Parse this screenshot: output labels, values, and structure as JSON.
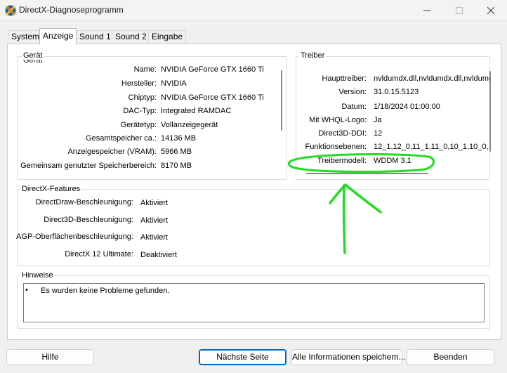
{
  "window": {
    "title": "DirectX-Diagnoseprogramm"
  },
  "tabs": [
    {
      "label": "System",
      "active": false
    },
    {
      "label": "Anzeige",
      "active": true
    },
    {
      "label": "Sound 1",
      "active": false
    },
    {
      "label": "Sound 2",
      "active": false
    },
    {
      "label": "Eingabe",
      "active": false
    }
  ],
  "device": {
    "title": "Gerät",
    "rows": [
      {
        "label": "Name:",
        "value": "NVIDIA GeForce GTX 1660 Ti"
      },
      {
        "label": "Hersteller:",
        "value": "NVIDIA"
      },
      {
        "label": "Chiptyp:",
        "value": "NVIDIA GeForce GTX 1660 Ti"
      },
      {
        "label": "DAC-Typ:",
        "value": "Integrated RAMDAC"
      },
      {
        "label": "Gerätetyp:",
        "value": "Vollanzeigegerät"
      },
      {
        "label": "Gesamtspeicher ca.:",
        "value": "14136 MB"
      },
      {
        "label": "Anzeigespeicher (VRAM):",
        "value": "5966 MB"
      },
      {
        "label": "Gemeinsam genutzter Speicherbereich:",
        "value": "8170 MB"
      }
    ]
  },
  "driver": {
    "title": "Treiber",
    "rows": [
      {
        "label": "Haupttreiber:",
        "value": "nvldumdx.dll,nvldumdx.dll,nvldumd"
      },
      {
        "label": "Version:",
        "value": "31.0.15.5123"
      },
      {
        "label": "Datum:",
        "value": "1/18/2024 01:00:00"
      },
      {
        "label": "Mit WHQL-Logo:",
        "value": "Ja"
      },
      {
        "label": "Direct3D-DDI:",
        "value": "12"
      },
      {
        "label": "Funktionsebenen:",
        "value": "12_1,12_0,11_1,11_0,10_1,10_0,"
      },
      {
        "label": "Treibermodell:",
        "value": "WDDM 3.1"
      }
    ]
  },
  "features": {
    "title": "DirectX-Features",
    "rows": [
      {
        "label": "DirectDraw-Beschleunigung:",
        "value": "Aktiviert"
      },
      {
        "label": "Direct3D-Beschleunigung:",
        "value": "Aktiviert"
      },
      {
        "label": "AGP-Oberflächenbeschleunigung:",
        "value": "Aktiviert"
      },
      {
        "label": "DirectX 12 Ultimate:",
        "value": "Deaktiviert"
      }
    ]
  },
  "notes": {
    "title": "Hinweise",
    "bullet": "•",
    "items": [
      "Es wurden keine Probleme gefunden."
    ]
  },
  "buttons": {
    "help": "Hilfe",
    "next_page": "Nächste Seite",
    "save_all": "Alle Informationen speichem...",
    "exit": "Beenden"
  },
  "colors": {
    "annotation": "#22dd22",
    "accent": "#0067c0"
  }
}
